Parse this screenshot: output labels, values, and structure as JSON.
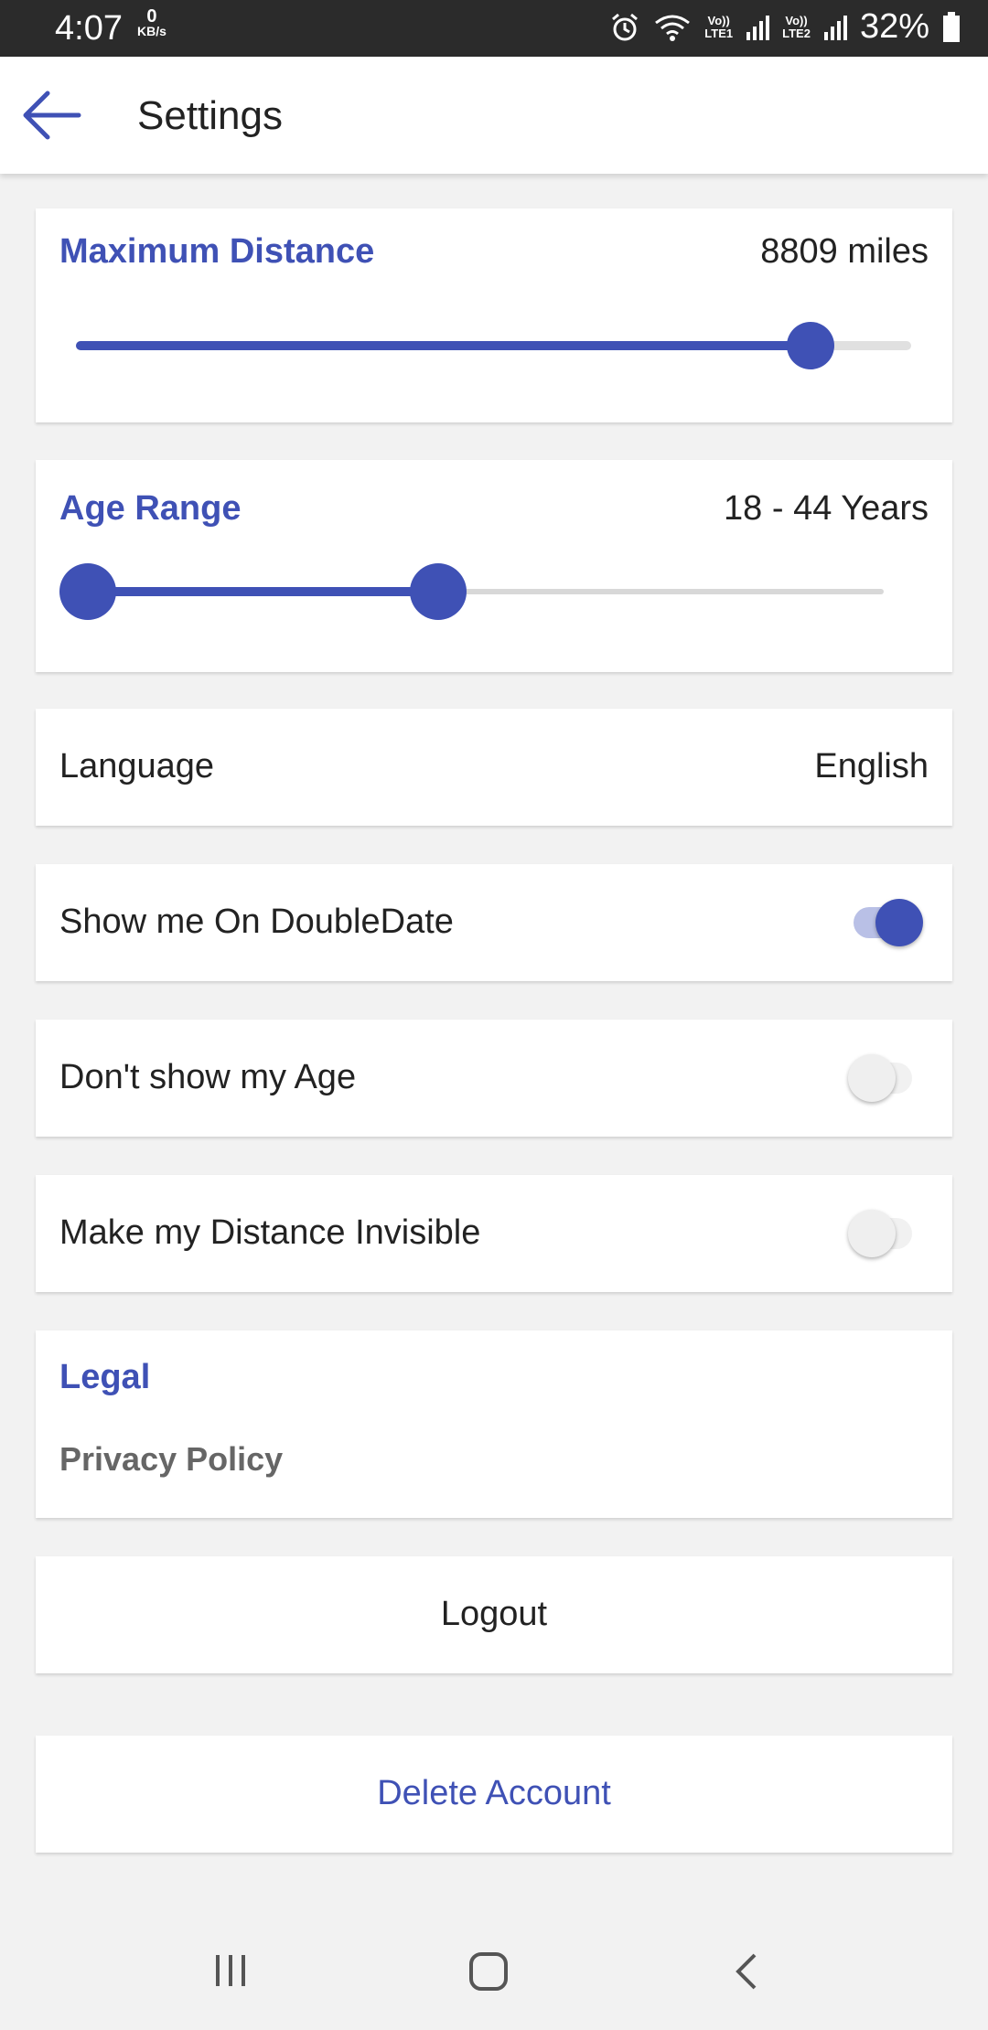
{
  "status_bar": {
    "time": "4:07",
    "net_speed_value": "0",
    "net_speed_unit": "KB/s",
    "sim1": "LTE1",
    "sim2": "LTE2",
    "volte": "Vo))",
    "battery": "32%"
  },
  "app_bar": {
    "title": "Settings"
  },
  "max_distance": {
    "label": "Maximum Distance",
    "value": "8809 miles",
    "slider_fraction": 0.88
  },
  "age_range": {
    "label": "Age Range",
    "value": "18 - 44 Years",
    "low_fraction": 0.0,
    "high_fraction": 0.44
  },
  "language": {
    "label": "Language",
    "value": "English"
  },
  "toggles": [
    {
      "label": "Show me On DoubleDate",
      "on": true
    },
    {
      "label": "Don't show my Age",
      "on": false
    },
    {
      "label": "Make my Distance Invisible",
      "on": false
    }
  ],
  "legal": {
    "heading": "Legal",
    "privacy": "Privacy Policy"
  },
  "buttons": {
    "logout": "Logout",
    "delete": "Delete Account"
  },
  "colors": {
    "accent": "#3f51b5",
    "accent_light": "#b9c0e6"
  }
}
